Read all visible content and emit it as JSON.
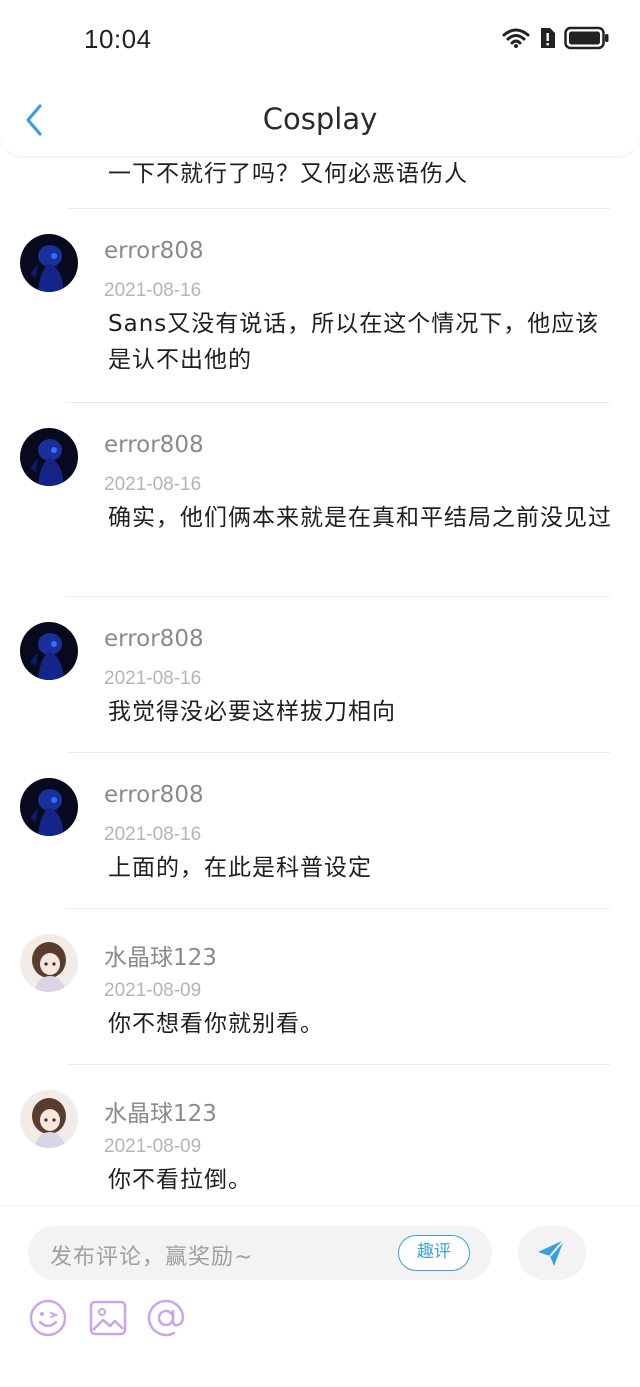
{
  "status": {
    "time": "10:04"
  },
  "header": {
    "title": "Cosplay"
  },
  "partial_comment": "一下不就行了吗？又何必恶语伤人",
  "comments": [
    {
      "user": "error808",
      "date": "2021-08-16",
      "text": "Sans又没有说话，所以在这个情况下，他应该是认不出他的"
    },
    {
      "user": "error808",
      "date": "2021-08-16",
      "text": "确实，他们俩本来就是在真和平结局之前没见过"
    },
    {
      "user": "error808",
      "date": "2021-08-16",
      "text": "我觉得没必要这样拔刀相向"
    },
    {
      "user": "error808",
      "date": "2021-08-16",
      "text": "上面的，在此是科普设定"
    },
    {
      "user": "水晶球123",
      "date": "2021-08-09",
      "text": "你不想看你就别看。"
    },
    {
      "user": "水晶球123",
      "date": "2021-08-09",
      "text": "你不看拉倒。"
    }
  ],
  "composer": {
    "placeholder": "发布评论，赢奖励~",
    "fun_label": "趣评"
  },
  "colors": {
    "accent": "#3aa0dc",
    "tool_purple": "#c9a6e8"
  }
}
